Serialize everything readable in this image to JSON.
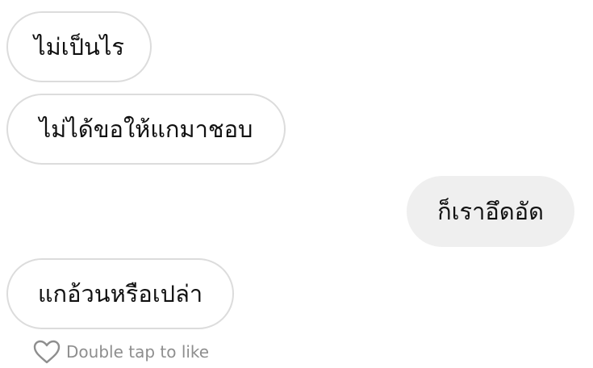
{
  "messages": [
    {
      "direction": "incoming",
      "text": "ไม่เป็นไร"
    },
    {
      "direction": "incoming",
      "text": "ไม่ได้ขอให้แกมาชอบ"
    },
    {
      "direction": "outgoing",
      "text": "ก็เราอึดอัด"
    },
    {
      "direction": "incoming",
      "text": "แกอ้วนหรือเปล่า"
    }
  ],
  "like_hint": {
    "icon": "heart-outline-icon",
    "label": "Double tap to like"
  },
  "colors": {
    "incoming_border": "#dcdcdc",
    "outgoing_background": "#efefef",
    "hint_text": "#8e8e8e"
  }
}
